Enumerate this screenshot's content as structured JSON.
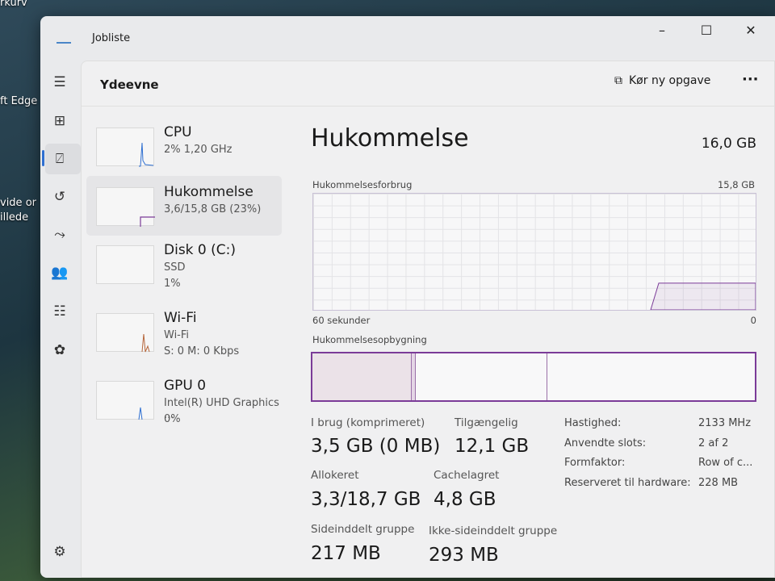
{
  "desktop": {
    "icons": [
      "rkurv",
      "ft Edge",
      "vide or",
      "illede"
    ]
  },
  "window": {
    "title": "Jobliste",
    "controls": [
      "–",
      "☐",
      "✕"
    ]
  },
  "header": {
    "title": "Ydeevne",
    "run_task": "Kør ny opgave",
    "more": "···"
  },
  "devices": [
    {
      "name": "CPU",
      "sub1": "2%  1,20 GHz",
      "sub2": ""
    },
    {
      "name": "Hukommelse",
      "sub1": "3,6/15,8 GB (23%)",
      "sub2": ""
    },
    {
      "name": "Disk 0 (C:)",
      "sub1": "SSD",
      "sub2": "1%"
    },
    {
      "name": "Wi-Fi",
      "sub1": "Wi-Fi",
      "sub2": "S: 0 M: 0 Kbps"
    },
    {
      "name": "GPU 0",
      "sub1": "Intel(R) UHD Graphics ...",
      "sub2": "0%"
    }
  ],
  "memory": {
    "title": "Hukommelse",
    "capacity": "16,0 GB",
    "usage_label": "Hukommelsesforbrug",
    "usage_max": "15,8 GB",
    "time_label": "60 sekunder",
    "zero": "0",
    "composition_label": "Hukommelsesopbygning",
    "usage_percent": 23,
    "stats": [
      {
        "label": "I brug (komprimeret)",
        "value": "3,5 GB (0 MB)"
      },
      {
        "label": "Tilgængelig",
        "value": "12,1 GB"
      },
      {
        "label": "Allokeret",
        "value": "3,3/18,7 GB"
      },
      {
        "label": "Cachelagret",
        "value": "4,8 GB"
      },
      {
        "label": "Sideinddelt gruppe",
        "value": "217 MB"
      },
      {
        "label": "Ikke-sideinddelt gruppe",
        "value": "293 MB"
      }
    ],
    "props": [
      {
        "k": "Hastighed:",
        "v": "2133 MHz"
      },
      {
        "k": "Anvendte slots:",
        "v": "2 af 2"
      },
      {
        "k": "Formfaktor:",
        "v": "Row of c..."
      },
      {
        "k": "Reserveret til hardware:",
        "v": "228 MB"
      }
    ]
  },
  "colors": {
    "memory": "#7b3b98",
    "cpu": "#2e6fd1",
    "wifi": "#b5653a"
  }
}
